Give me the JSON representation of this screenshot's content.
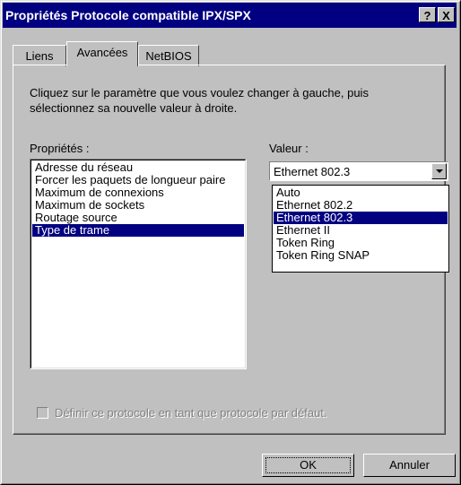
{
  "window": {
    "title": "Propriétés Protocole compatible IPX/SPX",
    "help_button": "?",
    "close_button": "X"
  },
  "tabs": [
    {
      "label": "Liens",
      "active": false
    },
    {
      "label": "Avancées",
      "active": true
    },
    {
      "label": "NetBIOS",
      "active": false
    }
  ],
  "instruction": "Cliquez sur le paramètre que vous voulez changer à gauche, puis sélectionnez sa nouvelle valeur à droite.",
  "properties": {
    "label": "Propriétés :",
    "items": [
      "Adresse du réseau",
      "Forcer les paquets de longueur paire",
      "Maximum de connexions",
      "Maximum de sockets",
      "Routage source",
      "Type de trame"
    ],
    "selected_index": 5
  },
  "value": {
    "label": "Valeur :",
    "selected": "Ethernet 802.3",
    "options": [
      "Auto",
      "Ethernet 802.2",
      "Ethernet 802.3",
      "Ethernet II",
      "Token Ring",
      "Token Ring SNAP"
    ],
    "highlighted_index": 2
  },
  "default_checkbox": {
    "label": "Définir ce protocole en tant que protocole par défaut.",
    "checked": false,
    "enabled": false
  },
  "buttons": {
    "ok": "OK",
    "cancel": "Annuler"
  }
}
